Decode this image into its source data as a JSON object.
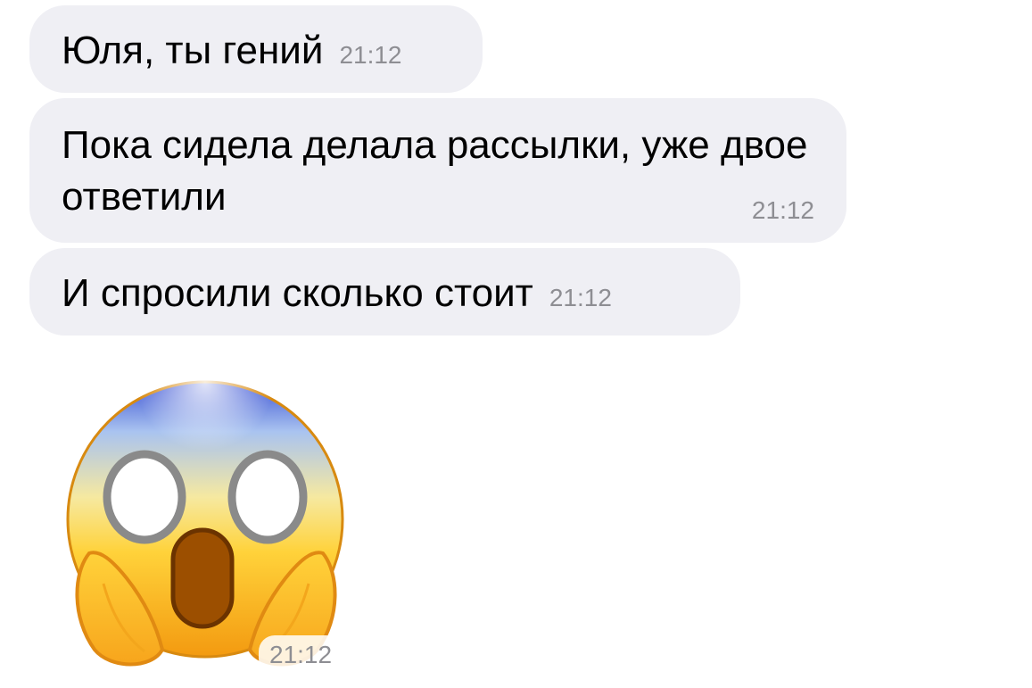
{
  "messages": [
    {
      "text": "Юля, ты гений",
      "time": "21:12"
    },
    {
      "text": "Пока сидела делала рассылки, уже двое ответили",
      "time": "21:12"
    },
    {
      "text": "И спросили сколько стоит",
      "time": "21:12"
    }
  ],
  "sticker": {
    "icon": "face-screaming-in-fear-icon",
    "time": "21:12"
  },
  "colors": {
    "bubble_bg": "#efeff4",
    "time_text": "#8e8e93"
  }
}
